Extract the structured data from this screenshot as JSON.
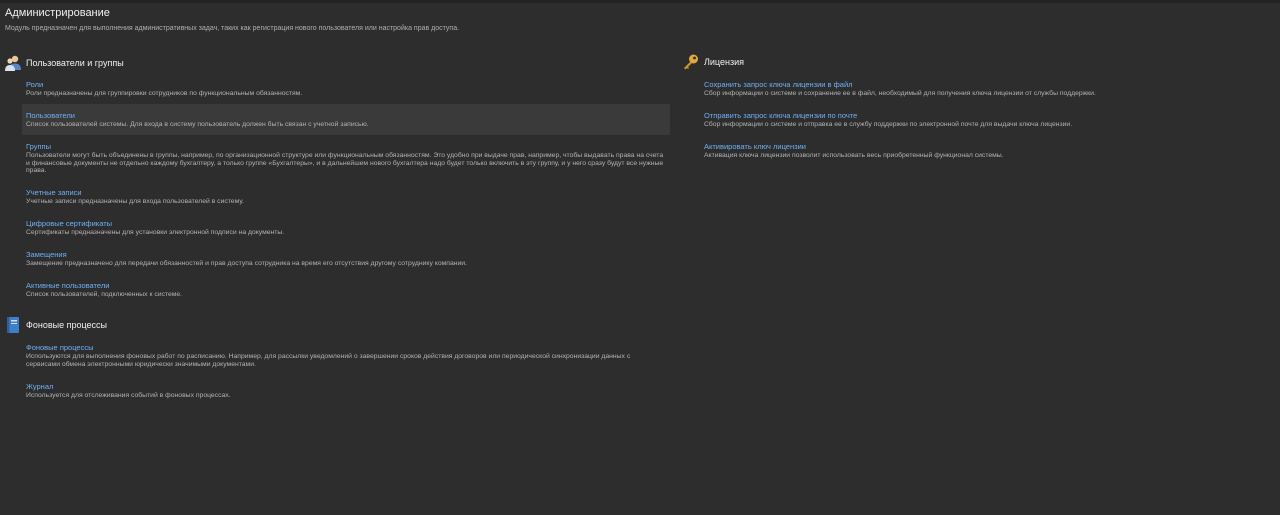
{
  "page": {
    "title": "Администрирование",
    "subtitle": "Модуль предназначен для выполнения административных задач, таких как регистрация нового пользователя или настройка прав доступа."
  },
  "users_section": {
    "title": "Пользователи и группы",
    "icon": "users-icon",
    "items": [
      {
        "title": "Роли",
        "desc": "Роли предназначены для группировки сотрудников по функциональным обязанностям."
      },
      {
        "title": "Пользователи",
        "desc": "Список пользователей системы. Для входа в систему пользователь должен быть связан с учетной записью."
      },
      {
        "title": "Группы",
        "desc": "Пользователи могут быть объединены в группы, например, по организационной структуре или функциональным обязанностям. Это удобно при выдаче прав, например, чтобы выдавать права на счета и финансовые документы не отдельно каждому бухгалтеру, а только группе «Бухгалтеры», и в дальнейшем нового бухгалтера надо будет только включить в эту группу, и у него сразу будут все нужные права."
      },
      {
        "title": "Учетные записи",
        "desc": "Учетные записи предназначены для входа пользователей в систему."
      },
      {
        "title": "Цифровые сертификаты",
        "desc": "Сертификаты предназначены для установки электронной подписи на документы."
      },
      {
        "title": "Замещения",
        "desc": "Замещение предназначено для передачи обязанностей и прав доступа сотрудника на время его отсутствия другому сотруднику компании."
      },
      {
        "title": "Активные пользователи",
        "desc": "Список пользователей, подключенных к системе."
      }
    ]
  },
  "background_section": {
    "title": "Фоновые процессы",
    "icon": "book-icon",
    "items": [
      {
        "title": "Фоновые процессы",
        "desc": "Используются для выполнения фоновых работ по расписанию. Например, для рассылки уведомлений о завершении сроков действия договоров или периодической синхронизации данных с сервисами обмена электронными юридически значимыми документами."
      },
      {
        "title": "Журнал",
        "desc": "Используется для отслеживания событий в фоновых процессах."
      }
    ]
  },
  "license_section": {
    "title": "Лицензия",
    "icon": "key-icon",
    "items": [
      {
        "title": "Сохранить запрос ключа лицензии в файл",
        "desc": "Сбор информации о системе и сохранение ее в файл, необходимый для получения ключа лицензии от службы поддержки."
      },
      {
        "title": "Отправить запрос ключа лицензии по почте",
        "desc": "Сбор информации о системе и отправка ее в службу поддержки по электронной почте для выдачи ключа лицензии."
      },
      {
        "title": "Активировать ключ лицензии",
        "desc": "Активация ключа лицензии позволит использовать весь приобретенный функционал системы."
      }
    ]
  },
  "colors": {
    "background": "#2d2d2d",
    "link": "#6fb1f4",
    "text": "#b3b3b3",
    "heading": "#f0f0f0"
  }
}
